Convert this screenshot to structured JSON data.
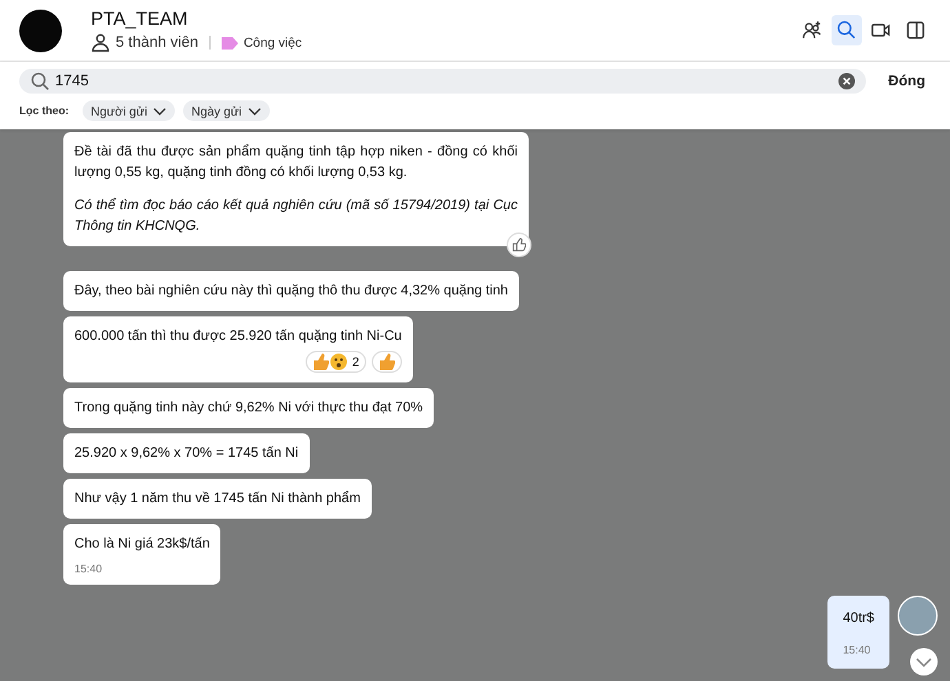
{
  "header": {
    "group_name": "PTA_TEAM",
    "members": "5 thành viên",
    "tag": {
      "label": "Công việc",
      "color": "#e58be5"
    },
    "toolbar": [
      {
        "kind": "add-member",
        "selected": false
      },
      {
        "kind": "search",
        "selected": true
      },
      {
        "kind": "video",
        "selected": false
      },
      {
        "kind": "panel",
        "selected": false
      }
    ]
  },
  "search": {
    "value": "1745",
    "close_label": "Đóng",
    "filter_label": "Lọc theo:",
    "filters": [
      "Người gửi",
      "Ngày gửi"
    ]
  },
  "messages": [
    {
      "kind": "received",
      "paragraphs": [
        {
          "text": "Đề tài đã thu được sản phẩm quặng tinh tập hợp niken - đồng có khối lượng 0,55 kg, quặng tinh đồng có khối lượng 0,53 kg.",
          "italic": false
        },
        {
          "text": "Có thể tìm đọc báo cáo kết quả nghiên cứu (mã số 15794/2019) tại Cục Thông tin KHCNQG.",
          "italic": true
        }
      ],
      "like_button": true
    },
    {
      "kind": "received",
      "paragraphs": [
        {
          "text": "Đây, theo bài nghiên cứu này thì quặng thô thu được 4,32% quặng tinh",
          "italic": false
        }
      ]
    },
    {
      "kind": "received",
      "paragraphs": [
        {
          "text": "600.000 tấn thì thu được 25.920 tấn quặng tinh Ni-Cu",
          "italic": false
        }
      ],
      "reaction_count": "2"
    },
    {
      "kind": "received",
      "paragraphs": [
        {
          "text": "Trong quặng tinh này chứ 9,62% Ni với thực thu đạt 70%",
          "italic": false
        }
      ]
    },
    {
      "kind": "received",
      "paragraphs": [
        {
          "text": "25.920 x 9,62% x 70% = 1745 tấn Ni",
          "italic": false
        }
      ]
    },
    {
      "kind": "received",
      "paragraphs": [
        {
          "text": "Như vậy 1 năm thu về 1745 tấn Ni thành phẩm",
          "italic": false
        }
      ]
    },
    {
      "kind": "received",
      "paragraphs": [
        {
          "text": "Cho là Ni giá 23k$/tấn",
          "italic": false
        }
      ],
      "time": "15:40"
    },
    {
      "kind": "sent",
      "paragraphs": [
        {
          "text": "40tr$",
          "italic": false
        }
      ],
      "time": "15:40"
    }
  ]
}
